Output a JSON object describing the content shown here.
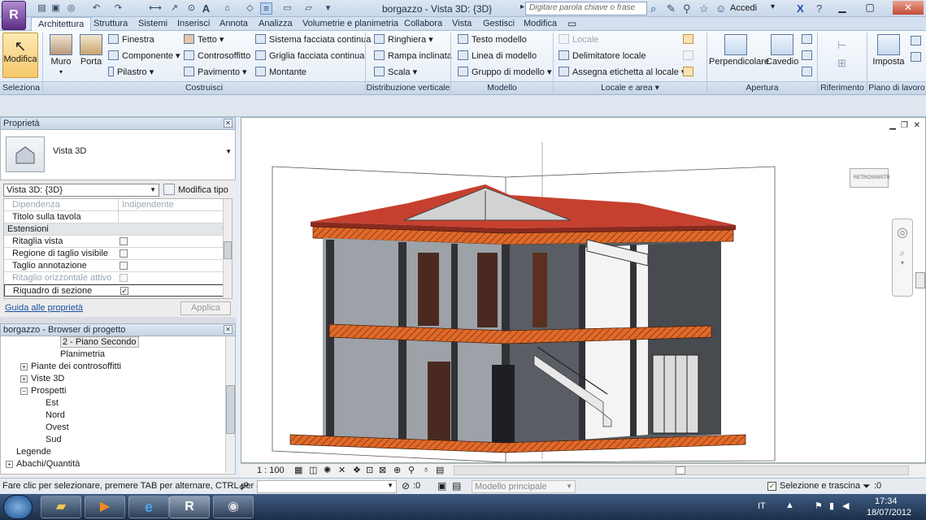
{
  "app": {
    "logo": "R",
    "title": "borgazzo - Vista 3D: {3D}",
    "search_placeholder": "Digitare parola chiave o frase",
    "signin": "Accedi"
  },
  "tabs": [
    {
      "label": "Architettura",
      "active": true
    },
    {
      "label": "Struttura"
    },
    {
      "label": "Sistemi"
    },
    {
      "label": "Inserisci"
    },
    {
      "label": "Annota"
    },
    {
      "label": "Analizza"
    },
    {
      "label": "Volumetrie e planimetria"
    },
    {
      "label": "Collabora"
    },
    {
      "label": "Vista"
    },
    {
      "label": "Gestisci"
    },
    {
      "label": "Modifica"
    }
  ],
  "ribbon": {
    "select": {
      "button": "Modifica",
      "panel": "Seleziona"
    },
    "build": {
      "panel": "Costruisci",
      "muro": "Muro",
      "porta": "Porta",
      "finestra": "Finestra",
      "componente": "Componente",
      "pilastro": "Pilastro",
      "tetto": "Tetto",
      "controsoffitto": "Controsoffitto",
      "pavimento": "Pavimento",
      "sistema": "Sistema facciata continua",
      "griglia": "Griglia facciata continua",
      "montante": "Montante"
    },
    "circulation": {
      "panel": "Distribuzione verticale",
      "ringhiera": "Ringhiera",
      "rampa": "Rampa inclinata",
      "scala": "Scala"
    },
    "model": {
      "panel": "Modello",
      "testo": "Testo modello",
      "linea": "Linea di modello",
      "gruppo": "Gruppo di modello"
    },
    "room": {
      "panel": "Locale e area",
      "locale": "Locale",
      "delimitatore": "Delimitatore  locale",
      "etichetta": "Assegna etichetta  al locale"
    },
    "opening": {
      "panel": "Apertura",
      "perpendicolare": "Perpendicolare",
      "cavedio": "Cavedio"
    },
    "datum": {
      "panel": "Riferimento"
    },
    "workplane": {
      "panel": "Piano di lavoro",
      "imposta": "Imposta"
    }
  },
  "properties": {
    "title": "Proprietà",
    "type_name": "Vista 3D",
    "selector": "Vista 3D: {3D}",
    "edit_type": "Modifica tipo",
    "rows": [
      {
        "k": "Dipendenza",
        "v": "Indipendente",
        "dim": true
      },
      {
        "k": "Titolo sulla tavola",
        "v": ""
      },
      {
        "group": "Estensioni"
      },
      {
        "k": "Ritaglia vista",
        "check": ""
      },
      {
        "k": "Regione di taglio visibile",
        "check": ""
      },
      {
        "k": "Taglio annotazione",
        "check": ""
      },
      {
        "k": "Ritaglio orizzontale attivo",
        "check": "",
        "dim": true
      },
      {
        "k": "Riquadro di sezione",
        "check": "✓"
      }
    ],
    "help": "Guida alle proprietà",
    "apply": "Applica"
  },
  "browser": {
    "title": "borgazzo - Browser di progetto",
    "items": [
      {
        "label": "2 - Piano Secondo",
        "indent": 3,
        "selected": true
      },
      {
        "label": "Planimetria",
        "indent": 3
      },
      {
        "label": "Piante dei controsoffitti",
        "indent": 1,
        "exp": "+"
      },
      {
        "label": "Viste 3D",
        "indent": 1,
        "exp": "+"
      },
      {
        "label": "Prospetti",
        "indent": 1,
        "exp": "−"
      },
      {
        "label": "Est",
        "indent": 2
      },
      {
        "label": "Nord",
        "indent": 2
      },
      {
        "label": "Ovest",
        "indent": 2
      },
      {
        "label": "Sud",
        "indent": 2
      },
      {
        "label": "Legende",
        "indent": 0
      },
      {
        "label": "Abachi/Quantità",
        "indent": 0,
        "exp": "+"
      }
    ]
  },
  "viewbar": {
    "scale": "1 : 100"
  },
  "viewcube": {
    "left": "RETRO",
    "right": "SINISTR"
  },
  "status": {
    "hint": "Fare clic per selezionare, premere TAB per alternare, CTRL per aggi",
    "filter1": ":0",
    "model": "Modello principale",
    "drag": "Selezione e trascina",
    "filter2": ":0"
  },
  "taskbar": {
    "lang": "IT",
    "time": "17:34",
    "date": "18/07/2012"
  }
}
